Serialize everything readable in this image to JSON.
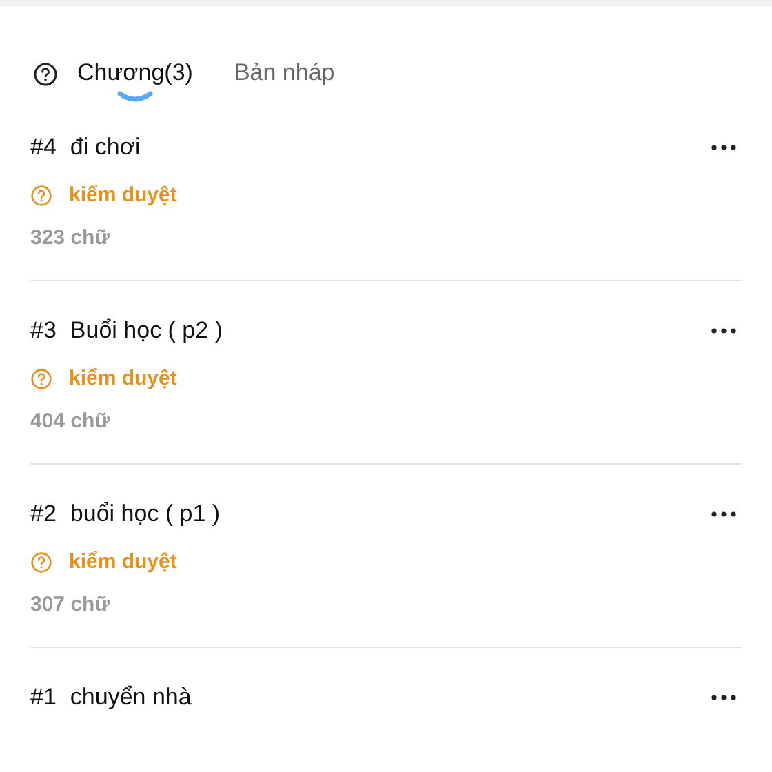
{
  "tabs": [
    {
      "label": "Chương(3)",
      "selected": true
    },
    {
      "label": "Bản nháp",
      "selected": false
    }
  ],
  "chapters": [
    {
      "number": "#4",
      "title": "đi chơi",
      "status": "kiểm duyệt",
      "words": "323 chữ"
    },
    {
      "number": "#3",
      "title": "Buổi học ( p2 )",
      "status": "kiểm duyệt",
      "words": "404 chữ"
    },
    {
      "number": "#2",
      "title": "buổi học ( p1 )",
      "status": "kiểm duyệt",
      "words": "307 chữ"
    },
    {
      "number": "#1",
      "title": "chuyển nhà"
    }
  ]
}
